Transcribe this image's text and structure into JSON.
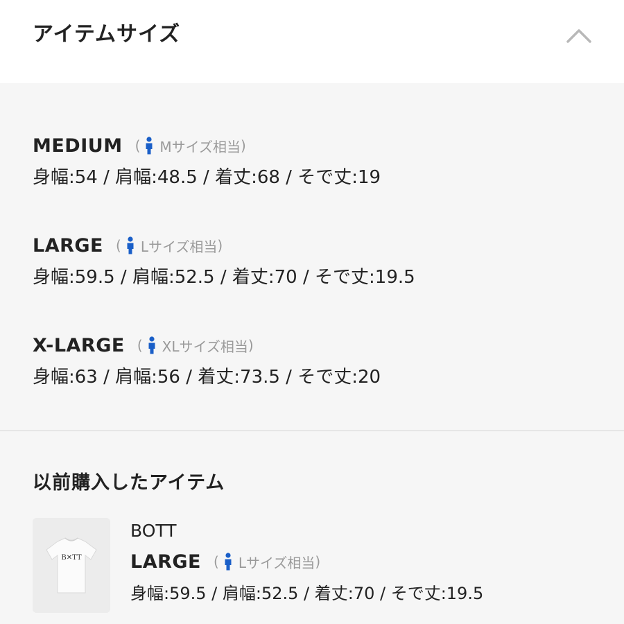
{
  "header": {
    "title": "アイテムサイズ"
  },
  "icons": {
    "collapse": "chevron-up-icon",
    "person": "person-icon"
  },
  "colors": {
    "person_icon": "#1a5fc8",
    "panel_bg": "#f6f6f6",
    "secondary_text": "#9a9a9a"
  },
  "sizes": [
    {
      "name": "MEDIUM",
      "open_paren": "(",
      "equiv": "Mサイズ相当",
      "close_paren": ")",
      "measurements": "身幅:54 / 肩幅:48.5 / 着丈:68 / そで丈:19"
    },
    {
      "name": "LARGE",
      "open_paren": "(",
      "equiv": "Lサイズ相当",
      "close_paren": ")",
      "measurements": "身幅:59.5 / 肩幅:52.5 / 着丈:70 / そで丈:19.5"
    },
    {
      "name": "X-LARGE",
      "open_paren": "(",
      "equiv": "XLサイズ相当",
      "close_paren": ")",
      "measurements": "身幅:63 / 肩幅:56 / 着丈:73.5 / そで丈:20"
    }
  ],
  "previous": {
    "title": "以前購入したアイテム",
    "item": {
      "brand": "BOTT",
      "size_name": "LARGE",
      "open_paren": "(",
      "equiv": "Lサイズ相当",
      "close_paren": ")",
      "measurements": "身幅:59.5 / 肩幅:52.5 / 着丈:70 / そで丈:19.5",
      "thumbnail_logo": "B✕TT"
    }
  }
}
